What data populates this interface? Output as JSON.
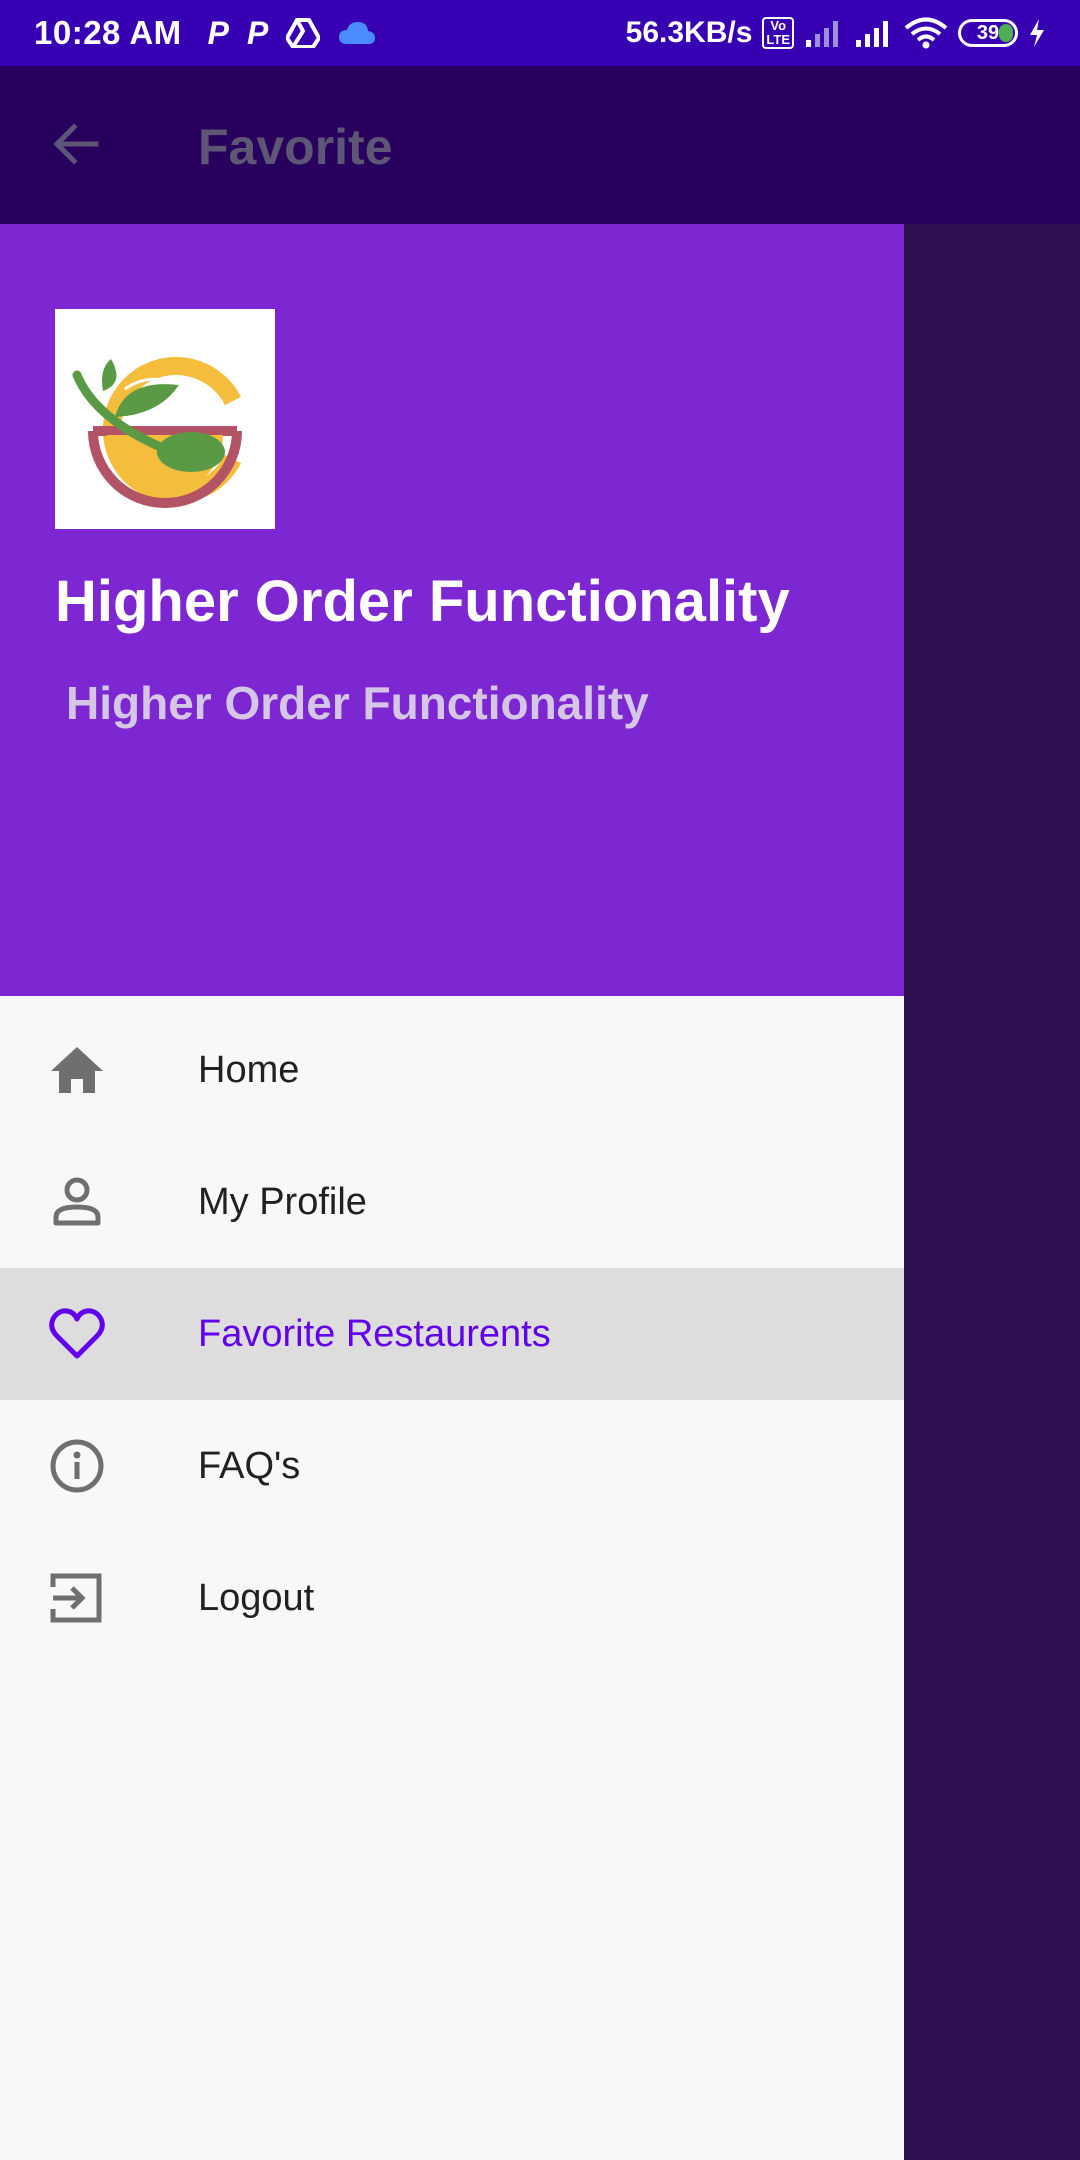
{
  "status_bar": {
    "time": "10:28 AM",
    "speed": "56.3KB/s",
    "volte_top": "Vo",
    "volte_bottom": "LTE",
    "battery": "39",
    "left_icons": [
      "parking-icon",
      "parking-icon",
      "drive-icon",
      "cloud-icon"
    ],
    "right_icons": [
      "volte-icon",
      "signal-icon",
      "signal-icon",
      "wifi-icon",
      "battery-icon",
      "charging-icon"
    ]
  },
  "app_bar": {
    "title": "Favorite",
    "back_icon": "arrow-back-icon"
  },
  "drawer": {
    "header": {
      "logo": "restaurant-logo",
      "title": "Higher Order Functionality",
      "subtitle": "Higher Order Functionality"
    },
    "items": [
      {
        "label": "Home",
        "icon": "home-icon",
        "selected": false
      },
      {
        "label": "My Profile",
        "icon": "person-icon",
        "selected": false
      },
      {
        "label": "Favorite Restaurents",
        "icon": "heart-icon",
        "selected": true
      },
      {
        "label": "FAQ's",
        "icon": "info-icon",
        "selected": false
      },
      {
        "label": "Logout",
        "icon": "logout-icon",
        "selected": false
      }
    ]
  },
  "colors": {
    "status_bar": "#3700b3",
    "drawer_header": "#7c27d2",
    "accent": "#6200ee",
    "scrim_background": "#2f1050"
  }
}
